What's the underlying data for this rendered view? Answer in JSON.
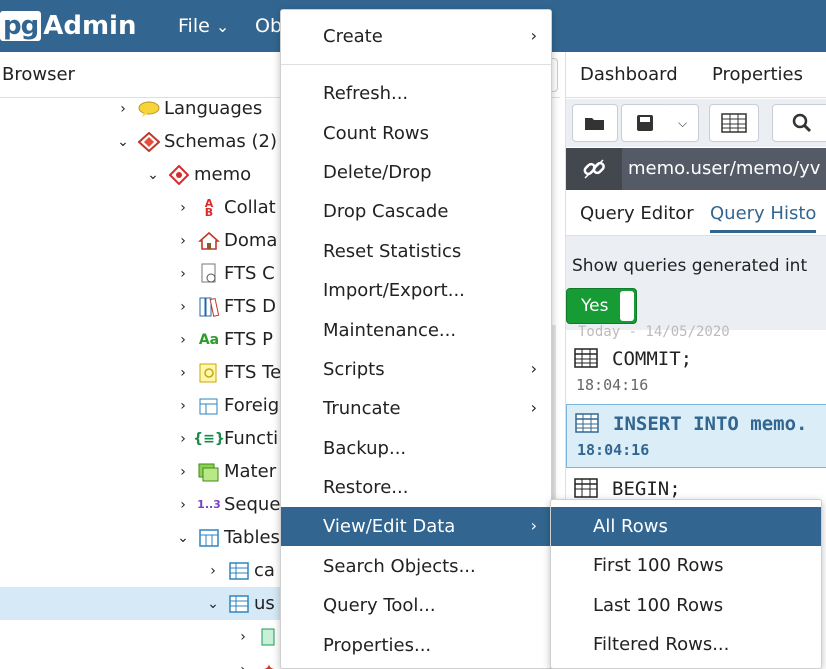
{
  "app": {
    "logo_pg": "pg",
    "logo_admin": "Admin"
  },
  "topmenu": {
    "file": "File",
    "file_chev": "⌄",
    "object_partial": "Ob"
  },
  "browser": {
    "title": "Browser",
    "tree": [
      {
        "chev": "›",
        "label": "Languages"
      },
      {
        "chev": "⌄",
        "label": "Schemas (2)"
      },
      {
        "chev": "⌄",
        "label": "memo"
      },
      {
        "chev": "›",
        "label": "Collat"
      },
      {
        "chev": "›",
        "label": "Doma"
      },
      {
        "chev": "›",
        "label": "FTS C"
      },
      {
        "chev": "›",
        "label": "FTS D"
      },
      {
        "chev": "›",
        "label": "FTS P"
      },
      {
        "chev": "›",
        "label": "FTS Te"
      },
      {
        "chev": "›",
        "label": "Foreig"
      },
      {
        "chev": "›",
        "label": "Functi"
      },
      {
        "chev": "›",
        "label": "Mater"
      },
      {
        "chev": "›",
        "label": "Seque"
      },
      {
        "chev": "⌄",
        "label": "Tables"
      },
      {
        "chev": "›",
        "label": "ca"
      },
      {
        "chev": "⌄",
        "label": "us"
      },
      {
        "chev": "›",
        "label": ""
      },
      {
        "chev": "›",
        "label": ""
      }
    ],
    "icons": {
      "fts_parser": "Aa",
      "sequence": "1..3"
    }
  },
  "right": {
    "tabs": {
      "dashboard": "Dashboard",
      "properties": "Properties"
    },
    "connection": "memo.user/memo/yv",
    "subtabs": {
      "query_editor": "Query Editor",
      "query_history": "Query Histo"
    },
    "history_label": "Show queries generated int",
    "toggle_label": "Yes",
    "date_partial": "Today - 14/05/2020",
    "entries": [
      {
        "query": "COMMIT;",
        "time": "18:04:16"
      },
      {
        "query": "INSERT INTO memo.",
        "time": "18:04:16"
      },
      {
        "query": "BEGIN;",
        "time": ""
      }
    ]
  },
  "context_menu": {
    "items": [
      {
        "label": "Create",
        "submenu": true
      },
      {
        "label": "Refresh...",
        "submenu": false
      },
      {
        "label": "Count Rows",
        "submenu": false
      },
      {
        "label": "Delete/Drop",
        "submenu": false
      },
      {
        "label": "Drop Cascade",
        "submenu": false
      },
      {
        "label": "Reset Statistics",
        "submenu": false
      },
      {
        "label": "Import/Export...",
        "submenu": false
      },
      {
        "label": "Maintenance...",
        "submenu": false
      },
      {
        "label": "Scripts",
        "submenu": true
      },
      {
        "label": "Truncate",
        "submenu": true
      },
      {
        "label": "Backup...",
        "submenu": false
      },
      {
        "label": "Restore...",
        "submenu": false
      },
      {
        "label": "View/Edit Data",
        "submenu": true
      },
      {
        "label": "Search Objects...",
        "submenu": false
      },
      {
        "label": "Query Tool...",
        "submenu": false
      },
      {
        "label": "Properties...",
        "submenu": false
      }
    ],
    "arrow": "›"
  },
  "submenu": {
    "items": [
      "All Rows",
      "First 100 Rows",
      "Last 100 Rows",
      "Filtered Rows..."
    ]
  },
  "colors": {
    "brand": "#326690",
    "toggle_on": "#179c35",
    "selection": "#d5e9f7"
  }
}
